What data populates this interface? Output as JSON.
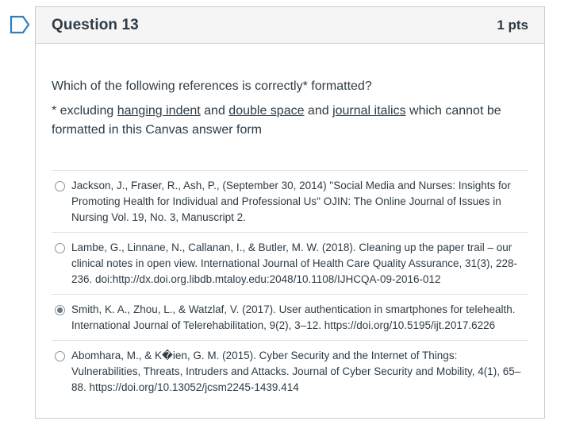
{
  "question": {
    "title": "Question 13",
    "points": "1 pts",
    "prompt": "Which of the following references is correctly* formatted?",
    "note": {
      "prefix": "* excluding ",
      "term1": "hanging indent",
      "mid1": " and ",
      "term2": "double space",
      "mid2": "  and ",
      "term3": "journal italics",
      "suffix": " which cannot be formatted in this Canvas answer form"
    }
  },
  "answers": [
    {
      "text": "Jackson, J., Fraser, R., Ash, P., (September 30, 2014) \"Social Media and Nurses: Insights for Promoting Health for Individual and Professional Us\" OJIN: The Online Journal of Issues in Nursing Vol. 19, No. 3, Manuscript 2.",
      "selected": false
    },
    {
      "text": "Lambe, G., Linnane, N., Callanan, I., & Butler, M. W. (2018). Cleaning up the paper trail – our clinical notes in open view. International Journal of Health Care Quality Assurance, 31(3), 228-236. doi:http://dx.doi.org.libdb.mtaloy.edu:2048/10.1108/IJHCQA-09-2016-012",
      "selected": false
    },
    {
      "text": "Smith, K. A., Zhou, L., & Watzlaf, V. (2017). User authentication in smartphones for telehealth. International Journal of Telerehabilitation, 9(2), 3–12. https://doi.org/10.5195/ijt.2017.6226",
      "selected": true
    },
    {
      "text": "Abomhara, M., & K�ien, G. M. (2015). Cyber Security and the Internet of Things: Vulnerabilities, Threats, Intruders and Attacks. Journal of Cyber Security and Mobility, 4(1), 65–88. https://doi.org/10.13052/jcsm2245-1439.414",
      "selected": false
    }
  ],
  "colors": {
    "flag": "#2d7fc0",
    "border": "#c7cdd1",
    "header_bg": "#f5f5f5"
  },
  "icons": {
    "flag": "flag-question-icon"
  }
}
